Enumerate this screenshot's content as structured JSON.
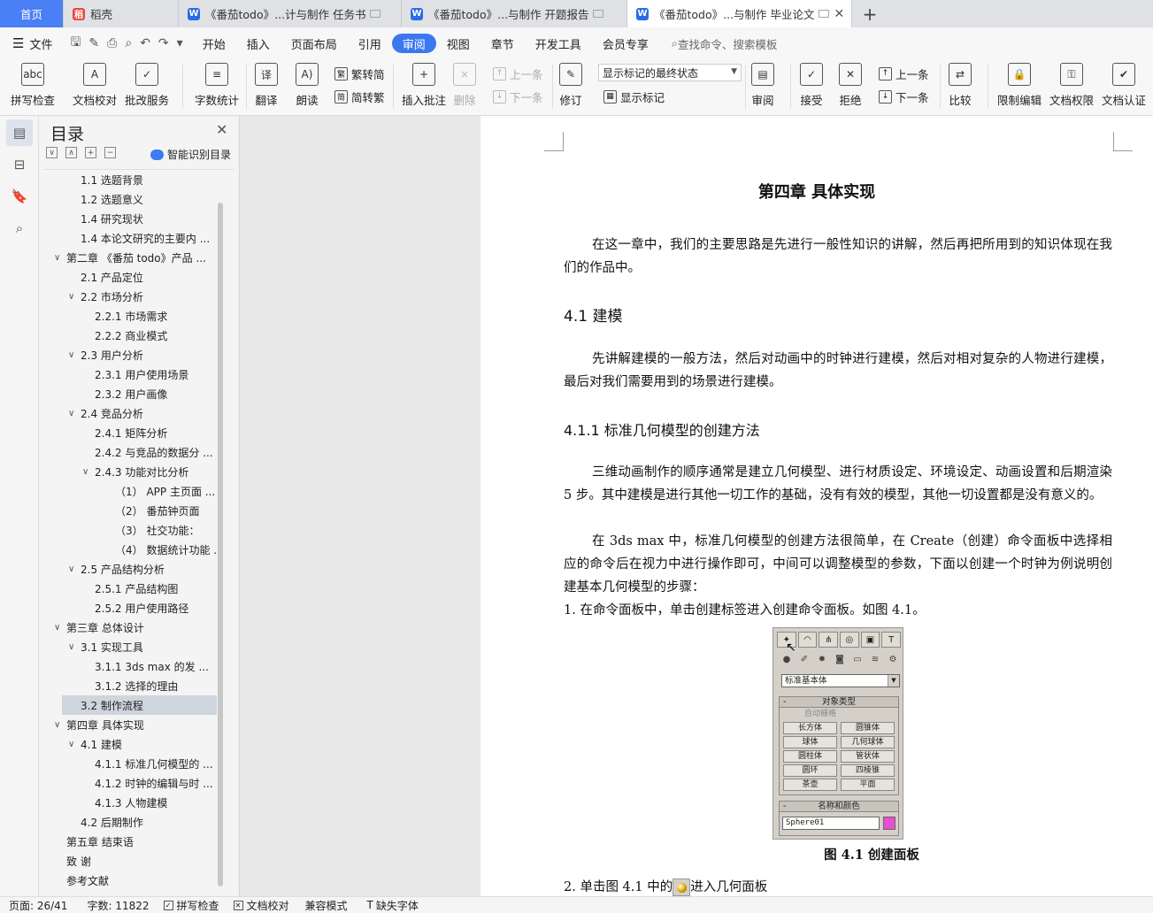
{
  "tabs": [
    {
      "label": "首页"
    },
    {
      "label": "稻壳"
    },
    {
      "label": "《番茄todo》...计与制作 任务书"
    },
    {
      "label": "《番茄todo》...与制作 开题报告"
    },
    {
      "label": "《番茄todo》...与制作 毕业论文"
    }
  ],
  "menu": {
    "file": "文件",
    "items": [
      "开始",
      "插入",
      "页面布局",
      "引用",
      "审阅",
      "视图",
      "章节",
      "开发工具",
      "会员专享"
    ],
    "active": "审阅",
    "search": "查找命令、搜索模板"
  },
  "ribbon": {
    "spell": "拼写检查",
    "proof": "文档校对",
    "revise_service": "批改服务",
    "word_count": "字数统计",
    "translate": "翻译",
    "read": "朗读",
    "to_trad": "繁转简",
    "to_simp": "简转繁",
    "insert_comment": "插入批注",
    "delete": "删除",
    "prev": "上一条",
    "next": "下一条",
    "track": "修订",
    "markup_select": "显示标记的最终状态",
    "show_markup": "显示标记",
    "review": "审阅",
    "accept": "接受",
    "reject": "拒绝",
    "prev2": "上一条",
    "next2": "下一条",
    "compare": "比较",
    "restrict": "限制编辑",
    "permission": "文档权限",
    "certify": "文档认证"
  },
  "toc": {
    "title": "目录",
    "smart": "智能识别目录",
    "items": [
      {
        "label": "1.1 选题背景"
      },
      {
        "label": "1.2 选题意义"
      },
      {
        "label": "1.4 研究现状"
      },
      {
        "label": "1.4 本论文研究的主要内 ..."
      },
      {
        "label": "第二章 《番茄 todo》产品 ..."
      },
      {
        "label": "2.1 产品定位"
      },
      {
        "label": "2.2 市场分析"
      },
      {
        "label": "2.2.1 市场需求"
      },
      {
        "label": "2.2.2  商业模式"
      },
      {
        "label": "2.3 用户分析"
      },
      {
        "label": "2.3.1 用户使用场景"
      },
      {
        "label": "2.3.2 用户画像"
      },
      {
        "label": "2.4 竞品分析"
      },
      {
        "label": "2.4.1  矩阵分析"
      },
      {
        "label": "2.4.2  与竞品的数据分 ..."
      },
      {
        "label": "2.4.3  功能对比分析"
      },
      {
        "label": "（1） APP 主页面 ..."
      },
      {
        "label": "（2） 番茄钟页面"
      },
      {
        "label": "（3） 社交功能："
      },
      {
        "label": "（4） 数据统计功能 ..."
      },
      {
        "label": "2.5 产品结构分析"
      },
      {
        "label": "2.5.1 产品结构图"
      },
      {
        "label": "2.5.2  用户使用路径"
      },
      {
        "label": "第三章  总体设计"
      },
      {
        "label": "3.1  实现工具"
      },
      {
        "label": "3.1.1 3ds max 的发 ..."
      },
      {
        "label": "3.1.2  选择的理由"
      },
      {
        "label": "3.2  制作流程"
      },
      {
        "label": "第四章  具体实现"
      },
      {
        "label": "4.1  建模"
      },
      {
        "label": "4.1.1  标准几何模型的 ..."
      },
      {
        "label": "4.1.2  时钟的编辑与时 ..."
      },
      {
        "label": "4.1.3  人物建模"
      },
      {
        "label": "4.2  后期制作"
      },
      {
        "label": "第五章  结束语"
      },
      {
        "label": "致      谢"
      },
      {
        "label": "参考文献"
      }
    ]
  },
  "doc": {
    "chapter": "第四章  具体实现",
    "p1": "在这一章中，我们的主要思路是先进行一般性知识的讲解，然后再把所用到的知识体现在我们的作品中。",
    "h41": "4.1  建模",
    "p2": "先讲解建模的一般方法，然后对动画中的时钟进行建模，然后对相对复杂的人物进行建模，最后对我们需要用到的场景进行建模。",
    "h411": "4.1.1  标准几何模型的创建方法",
    "p3": "三维动画制作的顺序通常是建立几何模型、进行材质设定、环境设定、动画设置和后期渲染 5 步。其中建模是进行其他一切工作的基础，没有有效的模型，其他一切设置都是没有意义的。",
    "p4": "在 3ds max 中，标准几何模型的创建方法很简单，在 Create（创建）命令面板中选择相应的命令后在视力中进行操作即可，中间可以调整模型的参数，下面以创建一个时钟为例说明创建基本几何模型的步骤：",
    "step1": "1.   在命令面板中，单击创建标签进入创建命令面板。如图 4.1。",
    "figure": {
      "dropdown": "标准基本体",
      "group1": "对象类型",
      "autogrid": "自动栅格",
      "buttons": [
        "长方体",
        "圆锥体",
        "球体",
        "几何球体",
        "圆柱体",
        "管状体",
        "圆环",
        "四棱锥",
        "茶壶",
        "平面"
      ],
      "group2": "名称和颜色",
      "name": "Sphere01"
    },
    "caption": "图 4.1  创建面板",
    "step2_a": "2.   单击图 4.1 中的",
    "step2_b": "进入几何面板"
  },
  "status": {
    "page": "页面: 26/41",
    "words": "字数: 11822",
    "spell": "拼写检查",
    "proof": "文档校对",
    "compat": "兼容模式",
    "missing_font": "缺失字体"
  }
}
